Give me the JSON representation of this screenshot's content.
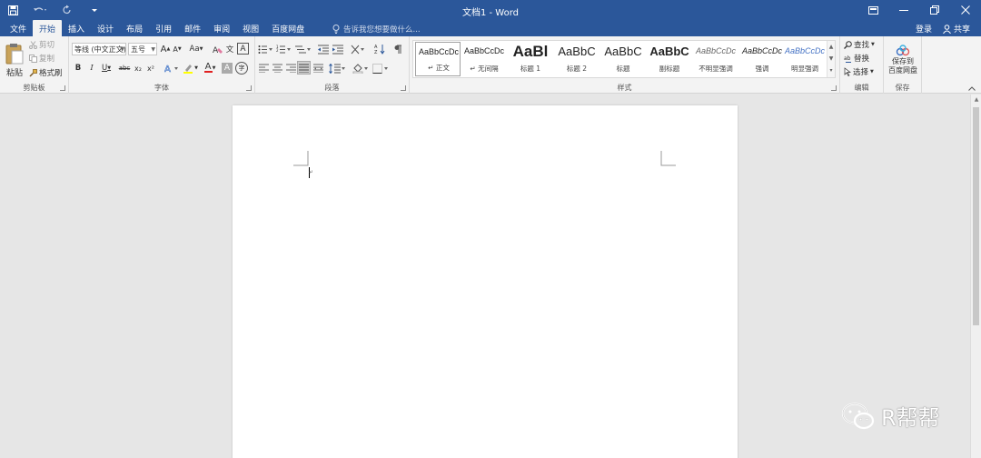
{
  "window": {
    "title": "文档1 - Word",
    "accent": "#2b579a"
  },
  "quick_access": {
    "icons": [
      "save-icon",
      "undo-icon",
      "redo-icon",
      "customize-qat-icon"
    ]
  },
  "window_controls": {
    "icons": [
      "ribbon-display-icon",
      "minimize-icon",
      "restore-icon",
      "close-icon"
    ]
  },
  "tabs": [
    {
      "label": "文件"
    },
    {
      "label": "开始",
      "active": true
    },
    {
      "label": "插入"
    },
    {
      "label": "设计"
    },
    {
      "label": "布局"
    },
    {
      "label": "引用"
    },
    {
      "label": "邮件"
    },
    {
      "label": "审阅"
    },
    {
      "label": "视图"
    },
    {
      "label": "百度网盘"
    }
  ],
  "tell_me": {
    "placeholder": "告诉我您想要做什么..."
  },
  "account": {
    "signin": "登录",
    "share": "共享"
  },
  "clipboard": {
    "paste": "粘贴",
    "cut": "剪切",
    "copy": "复制",
    "format_painter": "格式刷",
    "group_label": "剪贴板"
  },
  "font": {
    "font_name": "等线 (中文正文)",
    "font_size": "五号",
    "grow": "A",
    "shrink": "A",
    "change_case": "Aa",
    "pinyin": "文",
    "border_char": "A",
    "bold": "B",
    "italic": "I",
    "underline": "U",
    "strike": "abc",
    "subscript": "x₂",
    "superscript": "x²",
    "highlight": "ab",
    "font_color": "A",
    "shading": "A",
    "enclose": "字",
    "group_label": "字体"
  },
  "paragraph": {
    "group_label": "段落"
  },
  "styles": {
    "group_label": "样式",
    "items": [
      {
        "preview": "AaBbCcDc",
        "name": "↵ 正文",
        "selected": true
      },
      {
        "preview": "AaBbCcDc",
        "name": "↵ 无间隔"
      },
      {
        "preview": "AaBl",
        "name": "标题 1"
      },
      {
        "preview": "AaBbC",
        "name": "标题 2"
      },
      {
        "preview": "AaBbC",
        "name": "标题"
      },
      {
        "preview": "AaBbC",
        "name": "副标题"
      },
      {
        "preview": "AaBbCcDc",
        "name": "不明显强调"
      },
      {
        "preview": "AaBbCcDc",
        "name": "强调"
      },
      {
        "preview": "AaBbCcDc",
        "name": "明显强调"
      }
    ]
  },
  "editing": {
    "find": "查找",
    "replace": "替换",
    "select": "选择",
    "group_label": "编辑"
  },
  "save_group": {
    "button_line1": "保存到",
    "button_line2": "百度网盘",
    "group_label": "保存"
  },
  "watermark": {
    "text": "R帮帮"
  }
}
